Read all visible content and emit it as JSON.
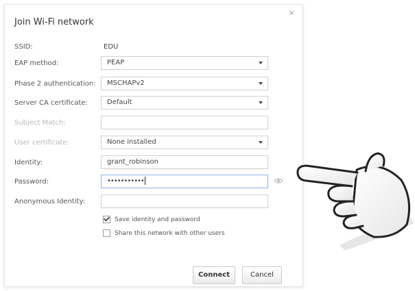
{
  "dialog": {
    "title": "Join Wi-Fi network",
    "close_glyph": "×"
  },
  "fields": {
    "ssid": {
      "label": "SSID:",
      "value": "EDU"
    },
    "eap_method": {
      "label": "EAP method:",
      "value": "PEAP"
    },
    "phase2": {
      "label": "Phase 2 authentication:",
      "value": "MSCHAPv2"
    },
    "server_ca": {
      "label": "Server CA certificate:",
      "value": "Default"
    },
    "subject_match": {
      "label": "Subject Match:",
      "value": ""
    },
    "user_cert": {
      "label": "User certificate:",
      "value": "None installed"
    },
    "identity": {
      "label": "Identity:",
      "value": "grant_robinson"
    },
    "password": {
      "label": "Password:",
      "value": "•••••••••••"
    },
    "anonymous_identity": {
      "label": "Anonymous Identity:",
      "value": ""
    }
  },
  "checkboxes": {
    "save_identity": {
      "label": "Save identity and password",
      "checked": true
    },
    "share_network": {
      "label": "Share this network with other users",
      "checked": false
    }
  },
  "buttons": {
    "connect": "Connect",
    "cancel": "Cancel"
  },
  "icons": {
    "close": "close-icon",
    "reveal_password": "eye-icon",
    "pointer": "pointing-hand-icon"
  },
  "colors": {
    "focus_border": "#8fb1ea",
    "disabled_label": "#b8b8b8"
  }
}
